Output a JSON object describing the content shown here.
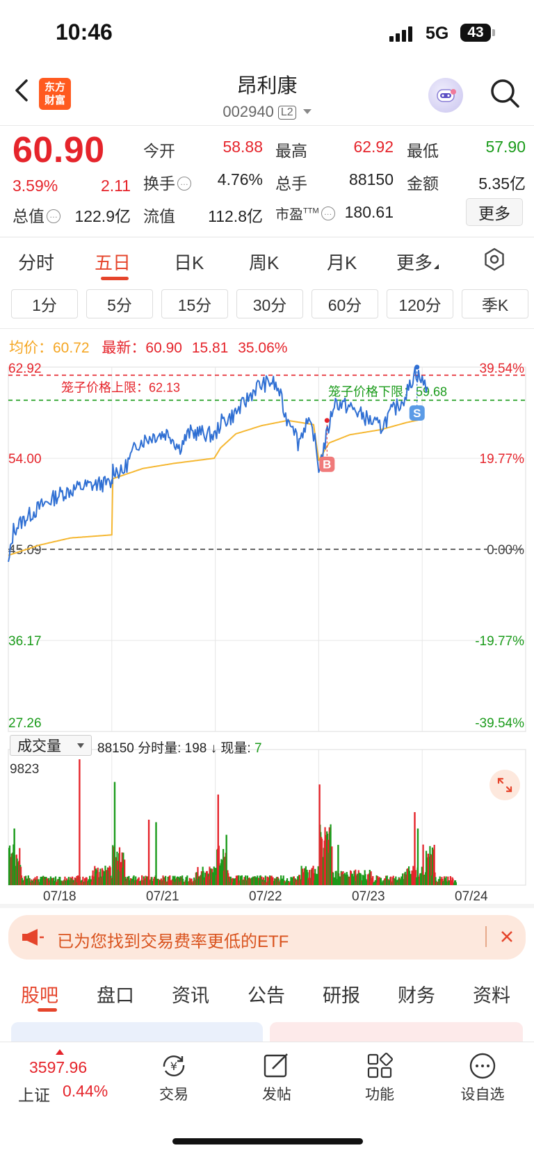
{
  "status_bar": {
    "time": "10:46",
    "network": "5G",
    "battery": "43"
  },
  "header": {
    "title": "昂利康",
    "code": "002940",
    "level_badge": "L2",
    "logo_line1": "东方",
    "logo_line2": "财富"
  },
  "quote": {
    "price": "60.90",
    "change_pct": "3.59%",
    "change_amt": "2.11",
    "open_label": "今开",
    "open": "58.88",
    "high_label": "最高",
    "high": "62.92",
    "low_label": "最低",
    "low": "57.90",
    "turnover_label": "换手",
    "turnover": "4.76%",
    "volume_label": "总手",
    "volume": "88150",
    "amount_label": "金额",
    "amount": "5.35亿",
    "mktcap_label": "总值",
    "mktcap": "122.9亿",
    "float_label": "流值",
    "float_cap": "112.8亿",
    "pe_label": "市盈",
    "pe_sup": "TTM",
    "pe": "180.61",
    "more": "更多",
    "info_glyph": "…"
  },
  "chart_tabs": [
    "分时",
    "五日",
    "日K",
    "周K",
    "月K",
    "更多"
  ],
  "active_chart_tab": "五日",
  "periods": [
    "1分",
    "5分",
    "15分",
    "30分",
    "60分",
    "120分",
    "季K"
  ],
  "legend": {
    "avg_label": "均价：",
    "avg": "60.72",
    "latest_label": "最新：",
    "latest": "60.90",
    "chg": "15.81",
    "chg_pct": "35.06%"
  },
  "chart_data": {
    "type": "line",
    "title": "",
    "x": [
      "07/18",
      "07/21",
      "07/22",
      "07/23",
      "07/24"
    ],
    "y_ticks": [
      "62.92",
      "54.00",
      "45.09",
      "36.17",
      "27.26"
    ],
    "pct_ticks": [
      "39.54%",
      "19.77%",
      "0.00%",
      "-19.77%",
      "-39.54%"
    ],
    "ylim": [
      27.26,
      62.92
    ],
    "base_price": 45.09,
    "upper_limit_label": "笼子价格上限：62.13",
    "upper_limit": 62.13,
    "lower_limit_label": "笼子价格下限：59.68",
    "lower_limit": 59.68,
    "buy_marker": "B",
    "sell_marker": "S",
    "series": [
      {
        "points": [
          [
            0,
            43.5
          ],
          [
            0.05,
            47
          ],
          [
            0.15,
            48
          ],
          [
            0.3,
            49.2
          ],
          [
            0.5,
            50.5
          ],
          [
            0.7,
            51.2
          ],
          [
            0.9,
            51.5
          ],
          [
            1.0,
            51.5
          ],
          [
            1.01,
            53
          ],
          [
            1.1,
            52.5
          ],
          [
            1.25,
            55.5
          ],
          [
            1.4,
            56.2
          ],
          [
            1.55,
            56.5
          ],
          [
            1.65,
            55
          ],
          [
            1.75,
            56.5
          ],
          [
            1.85,
            56.5
          ],
          [
            2.0,
            56.2
          ],
          [
            2.05,
            57.5
          ],
          [
            2.15,
            58
          ],
          [
            2.25,
            59
          ],
          [
            2.4,
            61
          ],
          [
            2.55,
            61.5
          ],
          [
            2.62,
            60.5
          ],
          [
            2.68,
            58
          ],
          [
            2.75,
            57.5
          ],
          [
            2.8,
            55.5
          ],
          [
            2.88,
            57.5
          ],
          [
            2.95,
            56.5
          ],
          [
            3.0,
            53
          ],
          [
            3.05,
            55
          ],
          [
            3.15,
            59.5
          ],
          [
            3.3,
            59
          ],
          [
            3.45,
            58
          ],
          [
            3.6,
            57
          ],
          [
            3.7,
            58.5
          ],
          [
            3.8,
            59.5
          ],
          [
            3.88,
            61
          ],
          [
            3.93,
            62.5
          ],
          [
            4.0,
            61.5
          ],
          [
            4.05,
            61
          ]
        ]
      },
      {
        "points": [
          [
            0,
            44.5
          ],
          [
            0.3,
            45.5
          ],
          [
            0.6,
            46.2
          ],
          [
            1.0,
            46.5
          ],
          [
            1.01,
            52
          ],
          [
            1.3,
            53
          ],
          [
            1.6,
            53.5
          ],
          [
            1.99,
            54
          ],
          [
            2.05,
            55
          ],
          [
            2.2,
            56.4
          ],
          [
            2.45,
            57.2
          ],
          [
            2.7,
            57.7
          ],
          [
            2.95,
            57.3
          ],
          [
            3.0,
            53.8
          ],
          [
            3.1,
            55.5
          ],
          [
            3.3,
            56.3
          ],
          [
            3.6,
            56.8
          ],
          [
            3.85,
            57.5
          ],
          [
            3.99,
            57.8
          ]
        ]
      }
    ],
    "volume_selector": "成交量",
    "volume_info": "88150 分时量: 198 ↓ 现量: 7",
    "volume_info_a": "88150 分时量: 198 ↓ 现量: ",
    "volume_info_b": "7",
    "volume_max": "9823",
    "volume": [
      {
        "x": 0.05,
        "v": 0.45
      },
      {
        "x": 0.68,
        "v": 1.0
      },
      {
        "x": 1.02,
        "v": 0.82
      },
      {
        "x": 1.35,
        "v": 0.52
      },
      {
        "x": 1.42,
        "v": 0.5
      },
      {
        "x": 2.02,
        "v": 0.72
      },
      {
        "x": 2.1,
        "v": 0.4
      },
      {
        "x": 3.0,
        "v": 0.8
      },
      {
        "x": 3.18,
        "v": 0.32
      },
      {
        "x": 3.92,
        "v": 0.58
      },
      {
        "x": 3.95,
        "v": 0.45
      },
      {
        "x": 4.05,
        "v": 0.25
      }
    ],
    "colors": {
      "price": "#2f6fd3",
      "avg": "#f5b731",
      "up": "#e5242b",
      "down": "#1a9b1a"
    }
  },
  "banner": {
    "text": "已为您找到交易费率更低的ETF"
  },
  "bottom_tabs": [
    "股吧",
    "盘口",
    "资讯",
    "公告",
    "研报",
    "财务",
    "资料"
  ],
  "bottom_nav": {
    "index_value": "3597.96",
    "index_name": "上证",
    "index_change": "0.44%",
    "items": [
      "交易",
      "发帖",
      "功能",
      "设自选"
    ]
  }
}
